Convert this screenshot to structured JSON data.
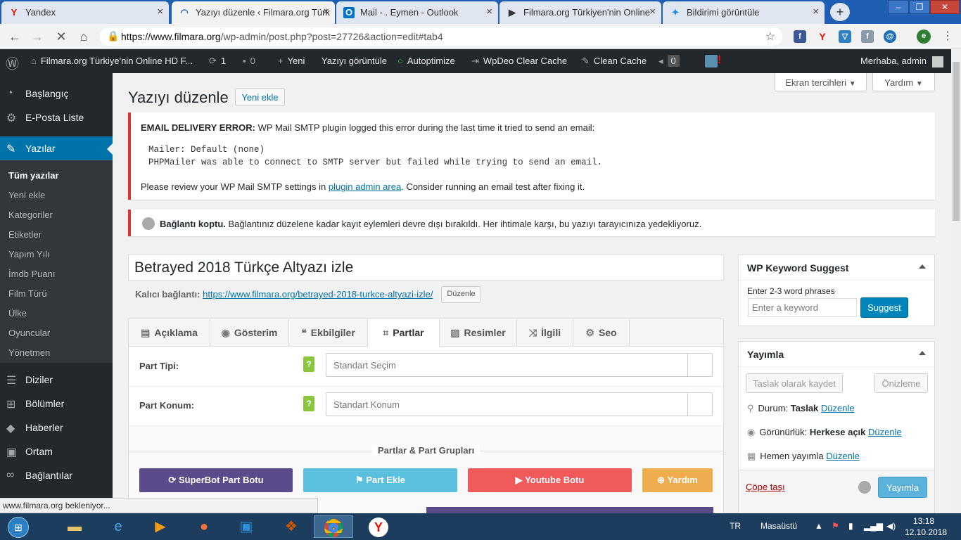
{
  "browser": {
    "tabs": [
      {
        "title": "Yandex",
        "fav": "Y",
        "fav_color": "#e61400"
      },
      {
        "title": "Yazıyı düzenle ‹ Filmara.org Türk",
        "fav": "◠",
        "fav_color": "#1e5fb3"
      },
      {
        "title": "Mail - . Eymen - Outlook",
        "fav": "O",
        "fav_color": "#0072c6"
      },
      {
        "title": "Filmara.org Türkiyen'nin Online",
        "fav": "▶",
        "fav_color": "#333333"
      },
      {
        "title": "Bildirimi görüntüle",
        "fav": "✦",
        "fav_color": "#1e88e5"
      }
    ],
    "url_host": "https://www.filmara.org",
    "url_path": "/wp-admin/post.php?post=27726&action=edit#tab4",
    "status_text": "www.filmara.org bekleniyor..."
  },
  "adminbar": {
    "site": "Filmara.org Türkiye'nin Online HD F...",
    "updates": "1",
    "comments": "0",
    "new": "Yeni",
    "view_post": "Yazıyı görüntüle",
    "autoptimize": "Autoptimize",
    "wpdeo": "WpDeo Clear Cache",
    "clean_cache": "Clean Cache",
    "badge": "0",
    "greeting": "Merhaba, admin"
  },
  "sidebar": {
    "items_top": [
      "Başlangıç",
      "E-Posta Liste"
    ],
    "current": "Yazılar",
    "submenu": [
      "Tüm yazılar",
      "Yeni ekle",
      "Kategoriler",
      "Etiketler",
      "Yapım Yılı",
      "İmdb Puanı",
      "Film Türü",
      "Ülke",
      "Oyuncular",
      "Yönetmen"
    ],
    "items_bottom": [
      "Diziler",
      "Bölümler",
      "Haberler",
      "Ortam",
      "Bağlantılar"
    ]
  },
  "header": {
    "screen_options": "Ekran tercihleri",
    "help": "Yardım",
    "title": "Yazıyı düzenle",
    "add_new": "Yeni ekle"
  },
  "notice_smtp": {
    "label": "EMAIL DELIVERY ERROR:",
    "text": " WP Mail SMTP plugin logged this error during the last time it tried to send an email:",
    "line1": "Mailer: Default (none)",
    "line2": "PHPMailer was able to connect to SMTP server but failed while trying to send an email.",
    "review_pre": "Please review your WP Mail SMTP settings in ",
    "review_link": "plugin admin area",
    "review_post": ". Consider running an email test after fixing it."
  },
  "notice_conn": {
    "label": "Bağlantı koptu.",
    "text": " Bağlantınız düzelene kadar kayıt eylemleri devre dışı bırakıldı. Her ihtimale karşı, bu yazıyı tarayıcınıza yedekliyoruz."
  },
  "post": {
    "title": "Betrayed 2018 Türkçe Altyazı izle",
    "permalink_label": "Kalıcı bağlantı:",
    "permalink_url": "https://www.filmara.org/betrayed-2018-turkce-altyazi-izle/",
    "edit_btn": "Düzenle"
  },
  "tabs": [
    "Açıklama",
    "Gösterim",
    "Ekbilgiler",
    "Partlar",
    "Resimler",
    "İlgili",
    "Seo"
  ],
  "fields": [
    {
      "label": "Part Tipi:",
      "placeholder": "Standart Seçim"
    },
    {
      "label": "Part Konum:",
      "placeholder": "Standart Konum"
    }
  ],
  "group_label": "Partlar & Part Grupları",
  "action_buttons": [
    {
      "label": "SüperBot Part Botu",
      "color": "#5b4b8a"
    },
    {
      "label": "Part Ekle",
      "color": "#5bc0de"
    },
    {
      "label": "Youtube Botu",
      "color": "#f05a5a"
    },
    {
      "label": "Yardım",
      "color": "#f0ad4e"
    }
  ],
  "keyword_box": {
    "title": "WP Keyword Suggest",
    "hint": "Enter 2-3 word phrases",
    "placeholder": "Enter a keyword",
    "button": "Suggest"
  },
  "publish_box": {
    "title": "Yayımla",
    "save_draft": "Taslak olarak kaydet",
    "preview": "Önizleme",
    "status_label": "Durum:",
    "status_value": "Taslak",
    "visibility_label": "Görünürlük:",
    "visibility_value": "Herkese açık",
    "publish_label": "Hemen",
    "publish_suffix": "yayımla",
    "edit": "Düzenle",
    "trash": "Çöpe taşı",
    "publish": "Yayımla"
  },
  "taskbar": {
    "lang": "TR",
    "desktop": "Masaüstü",
    "time": "13:18",
    "date": "12.10.2018"
  },
  "colors": {
    "wp_blue": "#0073aa",
    "admin_dark": "#23282d",
    "error_red": "#dc3232"
  }
}
